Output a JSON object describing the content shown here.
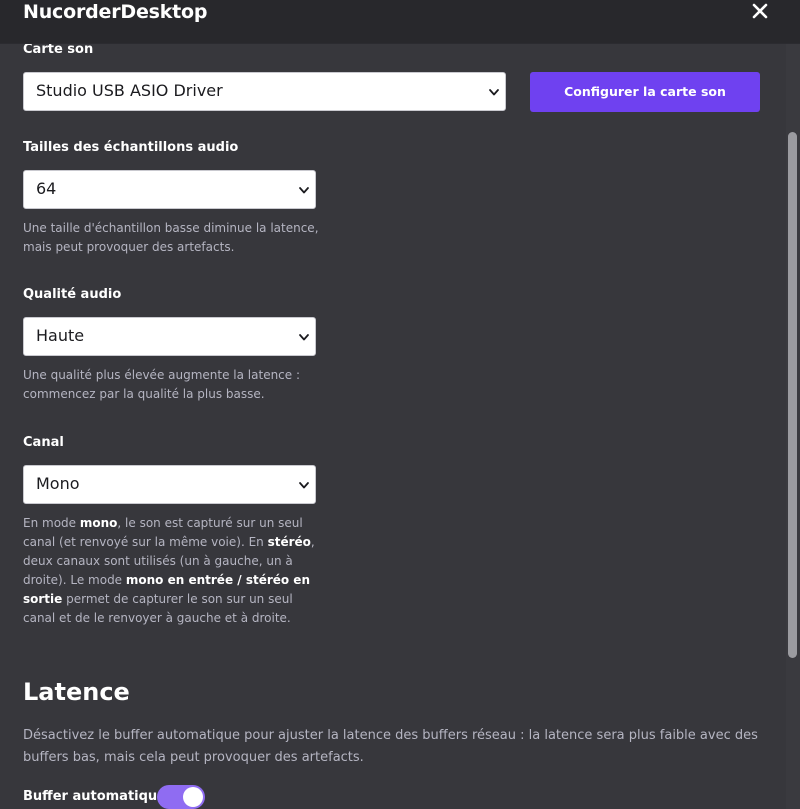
{
  "window": {
    "title": "NucorderDesktop",
    "close_icon": "close-icon"
  },
  "soundcard": {
    "label": "Carte son",
    "selected": "Studio USB ASIO Driver",
    "configure_label": "Configurer la carte son"
  },
  "sample_size": {
    "label": "Tailles des échantillons audio",
    "selected": "64",
    "hint_1": "Une taille d'échantillon basse diminue la latence,",
    "hint_2": "mais peut provoquer des artefacts."
  },
  "quality": {
    "label": "Qualité audio",
    "selected": "Haute",
    "hint_1": "Une qualité plus élevée augmente la latence :",
    "hint_2": "commencez par la qualité la plus basse."
  },
  "channel": {
    "label": "Canal",
    "selected": "Mono",
    "hint": {
      "p1": "En mode ",
      "b1": "mono",
      "p2": ", le son est capturé sur un seul canal (et renvoyé sur la même voie). En ",
      "b2": "stéréo",
      "p3": ", deux canaux sont utilisés (un à gauche, un à droite). Le mode ",
      "b3": "mono en entrée / stéréo en sortie",
      "p4": " permet de capturer le son sur un seul canal et de le renvoyer à gauche et à droite."
    }
  },
  "latency": {
    "title": "Latence",
    "description": "Désactivez le buffer automatique pour ajuster la latence des buffers réseau : la latence sera plus faible avec des buffers bas, mais cela peut provoquer des artefacts.",
    "auto_buffer_label": "Buffer automatique",
    "auto_buffer_on": true
  },
  "colors": {
    "accent": "#6f41f0",
    "toggle_on": "#8f6cf2",
    "background": "#37373c",
    "titlebar": "#28282c"
  }
}
